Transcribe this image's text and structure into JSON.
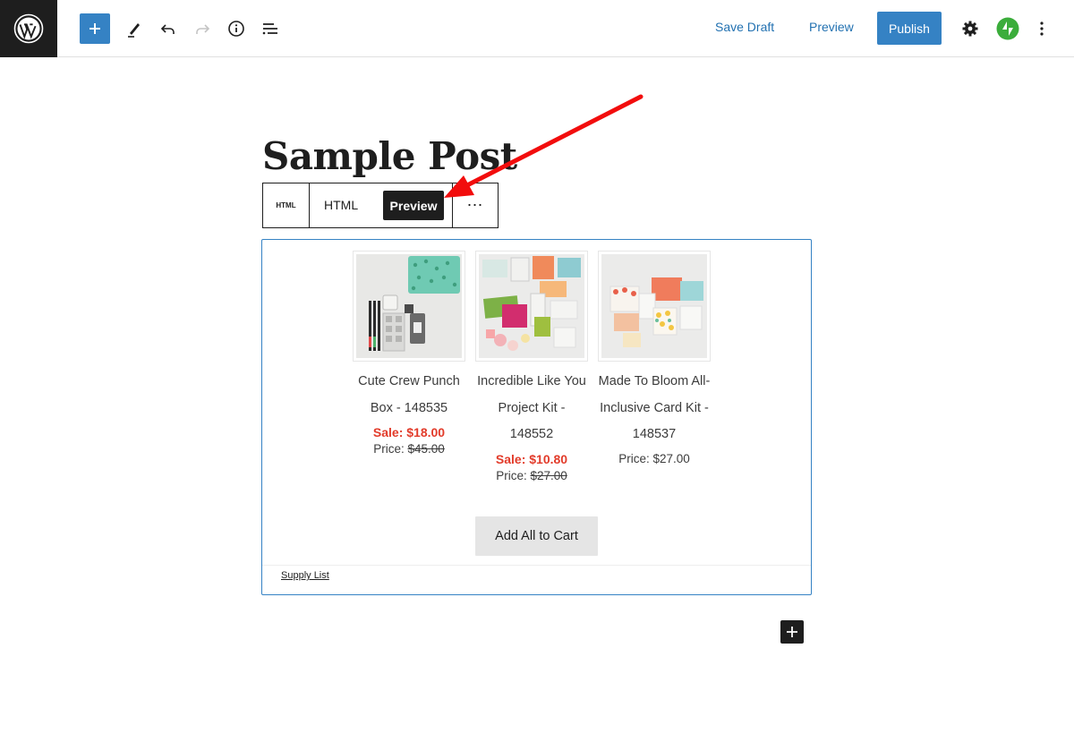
{
  "topbar": {
    "save_draft": "Save Draft",
    "preview": "Preview",
    "publish": "Publish"
  },
  "post": {
    "title": "Sample Post"
  },
  "block_toolbar": {
    "type_label": "HTML",
    "html_tab": "HTML",
    "preview_tab": "Preview",
    "more": "⋯"
  },
  "products": [
    {
      "name": "Cute Crew Punch Box - 148535",
      "sale_label": "Sale: $18.00",
      "price_label": "Price:",
      "price_value": "$45.00"
    },
    {
      "name": "Incredible Like You Project Kit - 148552",
      "sale_label": "Sale: $10.80",
      "price_label": "Price:",
      "price_value": "$27.00"
    },
    {
      "name": "Made To Bloom All-Inclusive Card Kit - 148537",
      "price_label": "Price:",
      "price_value": "$27.00"
    }
  ],
  "cart_button": "Add All to Cart",
  "supply_list": "Supply List",
  "colors": {
    "accent": "#3582c4",
    "sale": "#e23b2a",
    "annotation_arrow": "#f20d0d"
  }
}
